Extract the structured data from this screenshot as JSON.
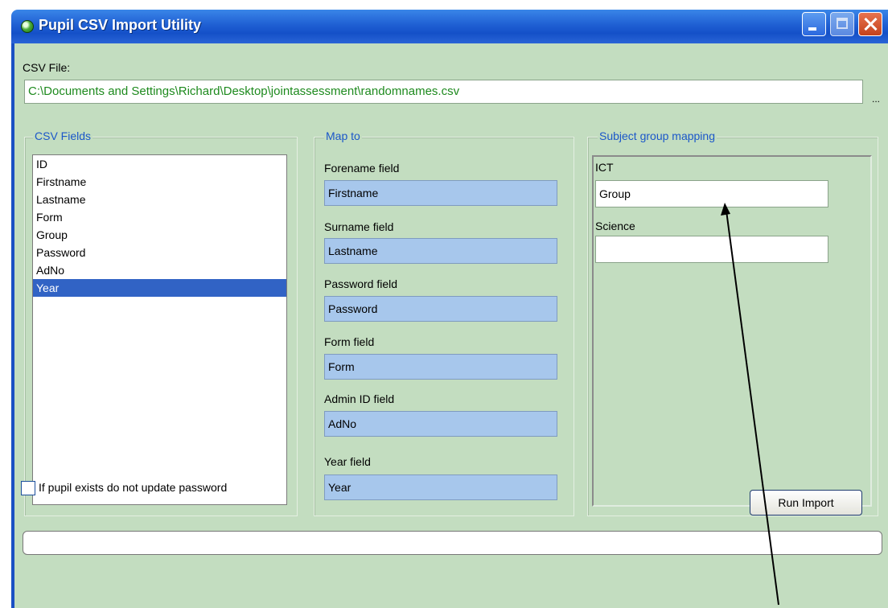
{
  "window": {
    "title": "Pupil CSV Import Utility"
  },
  "csv_file": {
    "label": "CSV File:",
    "path": "C:\\Documents and Settings\\Richard\\Desktop\\jointassessment\\randomnames.csv",
    "browse_label": "..."
  },
  "csv_fields": {
    "title": "CSV Fields",
    "items": [
      "ID",
      "Firstname",
      "Lastname",
      "Form",
      "Group",
      "Password",
      "AdNo",
      "Year"
    ],
    "selected": "Year"
  },
  "map_to": {
    "title": "Map to",
    "fields": [
      {
        "label": "Forename field",
        "value": "Firstname"
      },
      {
        "label": "Surname field",
        "value": "Lastname"
      },
      {
        "label": "Password field",
        "value": "Password"
      },
      {
        "label": "Form field",
        "value": "Form"
      },
      {
        "label": "Admin ID field",
        "value": "AdNo"
      },
      {
        "label": "Year field",
        "value": "Year"
      }
    ]
  },
  "subject_mapping": {
    "title": "Subject group mapping",
    "subjects": [
      {
        "label": "ICT",
        "value": "Group"
      },
      {
        "label": "Science",
        "value": ""
      }
    ]
  },
  "options": {
    "no_update_password_label": "If pupil exists do not update password",
    "no_update_password_checked": false
  },
  "actions": {
    "run_import_label": "Run Import"
  },
  "progress": {
    "value": 0
  },
  "colors": {
    "title_bar": "#1f5fd3",
    "client_bg": "#c3ddc0",
    "group_title": "#1b57c9",
    "map_field_bg": "#a7c7ec",
    "path_text": "#1e8a1e",
    "selection": "#3163c5"
  }
}
